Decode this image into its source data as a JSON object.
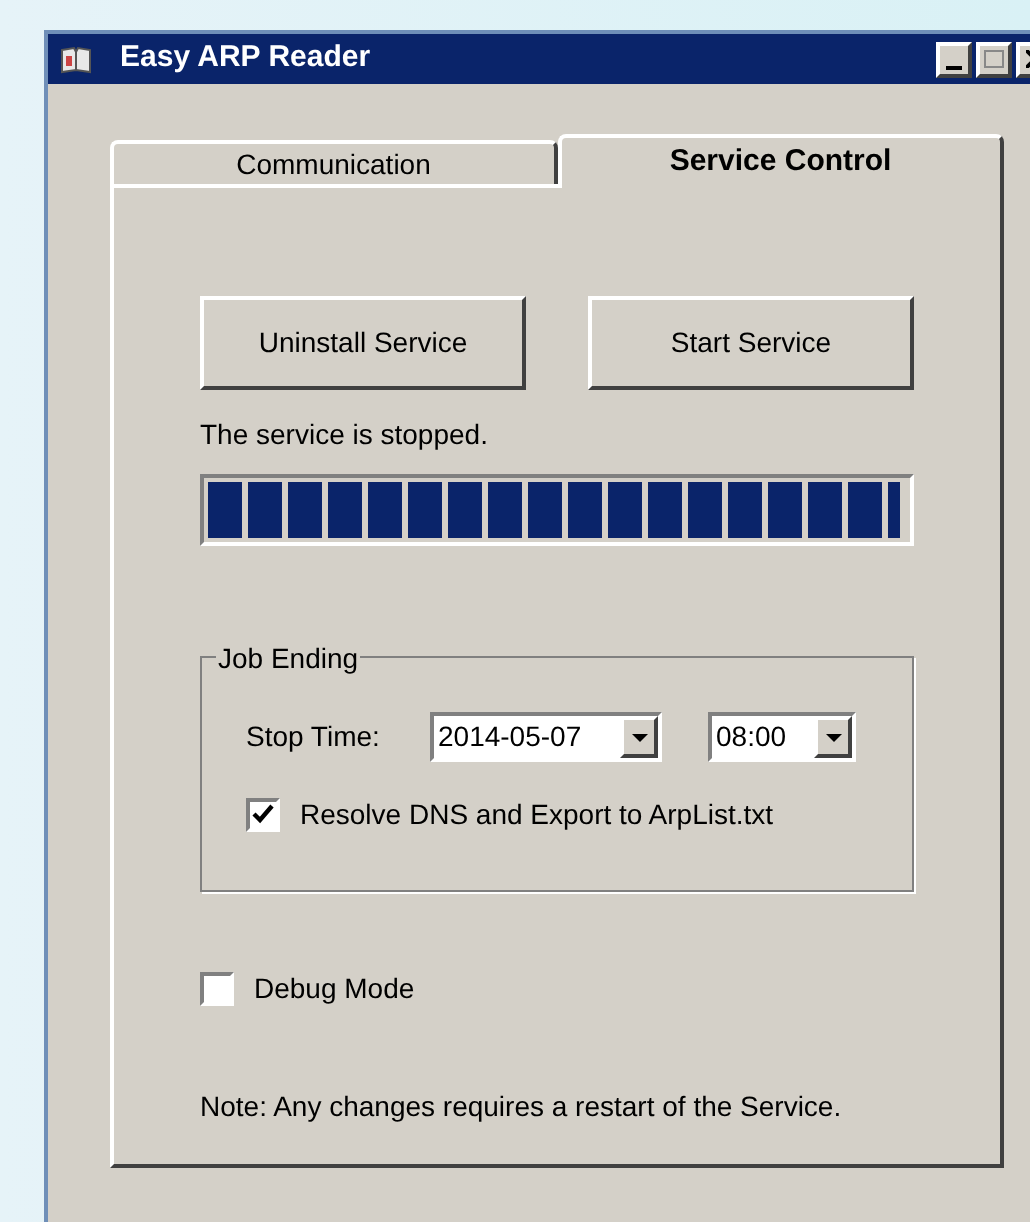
{
  "window": {
    "title": "Easy ARP Reader"
  },
  "tabs": [
    {
      "label": "Communication",
      "selected": false
    },
    {
      "label": "Service Control",
      "selected": true
    }
  ],
  "buttons": [
    "Uninstall Service",
    "Start Service"
  ],
  "status": "The service is stopped.",
  "progress": {
    "level": 0.99
  },
  "job_ending": {
    "title": "Job Ending",
    "stop_time_label": "Stop Time:",
    "date": "2014-05-07",
    "time": "08:00",
    "resolve": {
      "label": "Resolve DNS and Export to ArpList.txt",
      "checked": true
    }
  },
  "debug": {
    "label": "Debug Mode",
    "checked": false
  },
  "note": "Note: Any changes requires a restart of the Service."
}
